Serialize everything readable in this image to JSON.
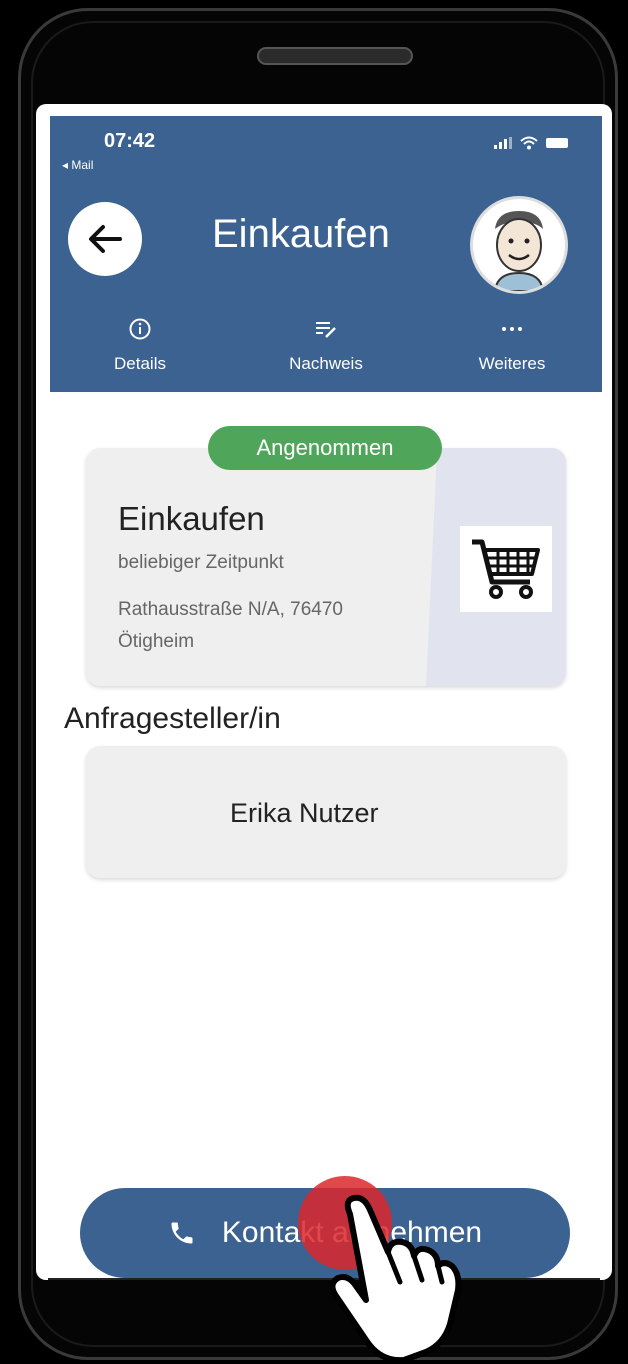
{
  "status": {
    "time": "07:42",
    "back_label": "◂ Mail"
  },
  "header": {
    "title": "Einkaufen"
  },
  "tabs": [
    {
      "label": "Details",
      "icon": "info-icon"
    },
    {
      "label": "Nachweis",
      "icon": "list-edit-icon"
    },
    {
      "label": "Weiteres",
      "icon": "more-icon"
    }
  ],
  "task": {
    "status_badge": "Angenommen",
    "title": "Einkaufen",
    "when": "beliebiger Zeitpunkt",
    "address_line1": "Rathausstraße N/A, 76470",
    "address_line2": "Ötigheim",
    "icon": "shopping-cart-icon"
  },
  "requester": {
    "section_title": "Anfragesteller/in",
    "name": "Erika Nutzer"
  },
  "cta": {
    "label": "Kontakt aufnehmen",
    "icon": "phone-icon"
  },
  "colors": {
    "primary": "#3b6290",
    "badge": "#4fa65a",
    "tap": "#dc282d"
  }
}
